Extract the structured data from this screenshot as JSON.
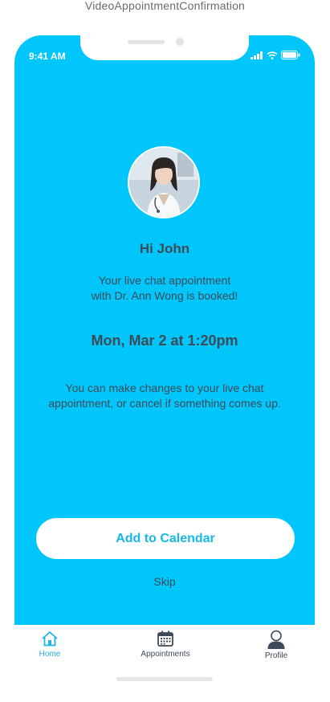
{
  "artboard": {
    "title": "VideoAppointmentConfirmation"
  },
  "status_bar": {
    "time": "9:41 AM"
  },
  "confirmation": {
    "avatar_icon": "doctor-photo",
    "greeting": "Hi John",
    "booked_line1": "Your live chat appointment",
    "booked_line2": "with Dr. Ann Wong is booked!",
    "datetime": "Mon, Mar 2 at 1:20pm",
    "changes_line1": "You can make changes to your live chat",
    "changes_line2": "appointment, or cancel if something comes up."
  },
  "actions": {
    "add_calendar": "Add to Calendar",
    "skip": "Skip"
  },
  "tabbar": {
    "tabs": [
      {
        "label": "Home",
        "icon": "home-icon",
        "active": true
      },
      {
        "label": "Appointments",
        "icon": "calendar-icon",
        "active": false
      },
      {
        "label": "Profile",
        "icon": "profile-icon",
        "active": false
      }
    ]
  },
  "colors": {
    "background": "#00c6fb",
    "accent": "#1fb5e5",
    "text": "#3e4a57",
    "button": "#ffffff"
  }
}
